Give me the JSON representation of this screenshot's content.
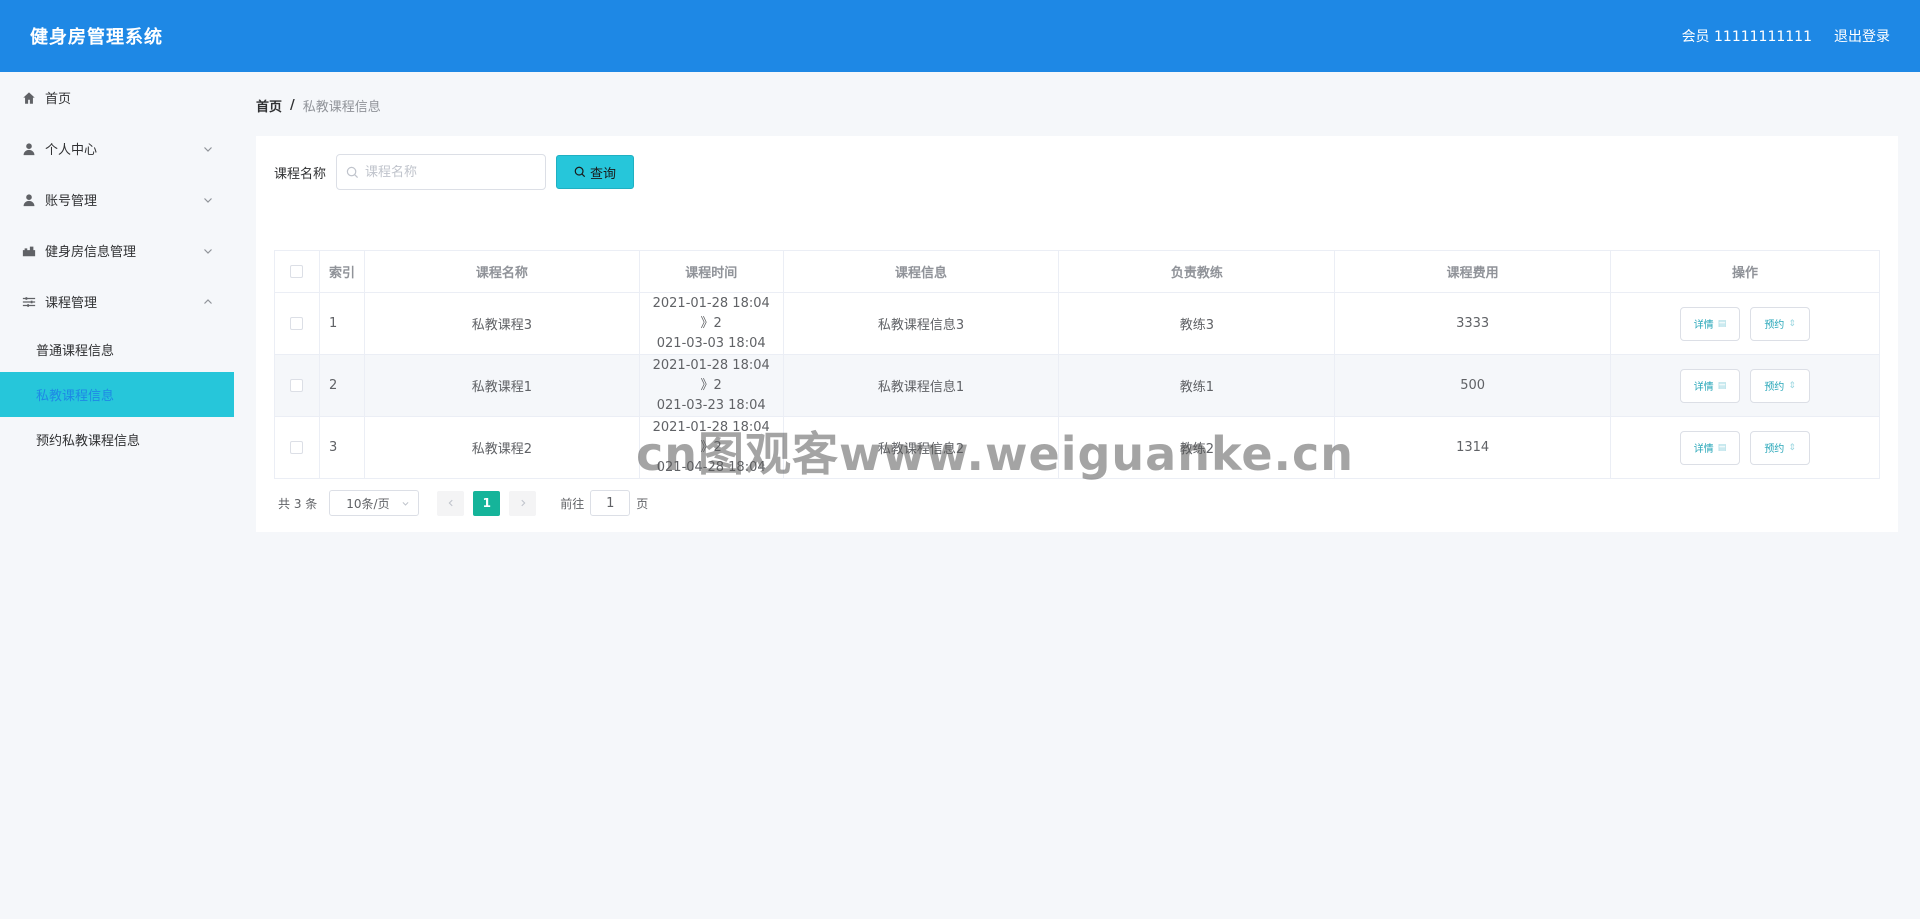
{
  "header": {
    "title": "健身房管理系统",
    "user_label": "会员 11111111111",
    "logout_label": "退出登录"
  },
  "sidebar": {
    "items": [
      {
        "label": "首页",
        "icon": "home-icon"
      },
      {
        "label": "个人中心",
        "icon": "user-icon"
      },
      {
        "label": "账号管理",
        "icon": "user-icon"
      },
      {
        "label": "健身房信息管理",
        "icon": "gym-icon"
      },
      {
        "label": "课程管理",
        "icon": "sliders-icon"
      }
    ],
    "sub_items": [
      {
        "label": "普通课程信息",
        "active": false
      },
      {
        "label": "私教课程信息",
        "active": true
      },
      {
        "label": "预约私教课程信息",
        "active": false
      }
    ]
  },
  "breadcrumb": {
    "home": "首页",
    "separator": "/",
    "current": "私教课程信息"
  },
  "search": {
    "label": "课程名称",
    "placeholder": "课程名称",
    "button_label": "查询"
  },
  "table": {
    "headers": [
      "",
      "索引",
      "课程名称",
      "课程时间",
      "课程信息",
      "负责教练",
      "课程费用",
      "操作"
    ],
    "rows": [
      {
        "index": "1",
        "name": "私教课程3",
        "time_line1": "2021-01-28 18:04 》2",
        "time_line2": "021-03-03 18:04",
        "info": "私教课程信息3",
        "coach": "教练3",
        "fee": "3333"
      },
      {
        "index": "2",
        "name": "私教课程1",
        "time_line1": "2021-01-28 18:04 》2",
        "time_line2": "021-03-23 18:04",
        "info": "私教课程信息1",
        "coach": "教练1",
        "fee": "500"
      },
      {
        "index": "3",
        "name": "私教课程2",
        "time_line1": "2021-01-28 18:04 》2",
        "time_line2": "021-04-28 18:04",
        "info": "私教课程信息2",
        "coach": "教练2",
        "fee": "1314"
      }
    ],
    "detail_label": "详情",
    "reserve_label": "预约"
  },
  "pagination": {
    "total": "共 3 条",
    "page_size": "10条/页",
    "current_page": "1",
    "goto_label": "前往",
    "goto_value": "1",
    "page_suffix": "页"
  },
  "watermark": "cn图观客www.weiguanke.cn",
  "colors": {
    "header": "#1e88e5",
    "accent": "#26c6da",
    "page_active": "#15b49a"
  }
}
